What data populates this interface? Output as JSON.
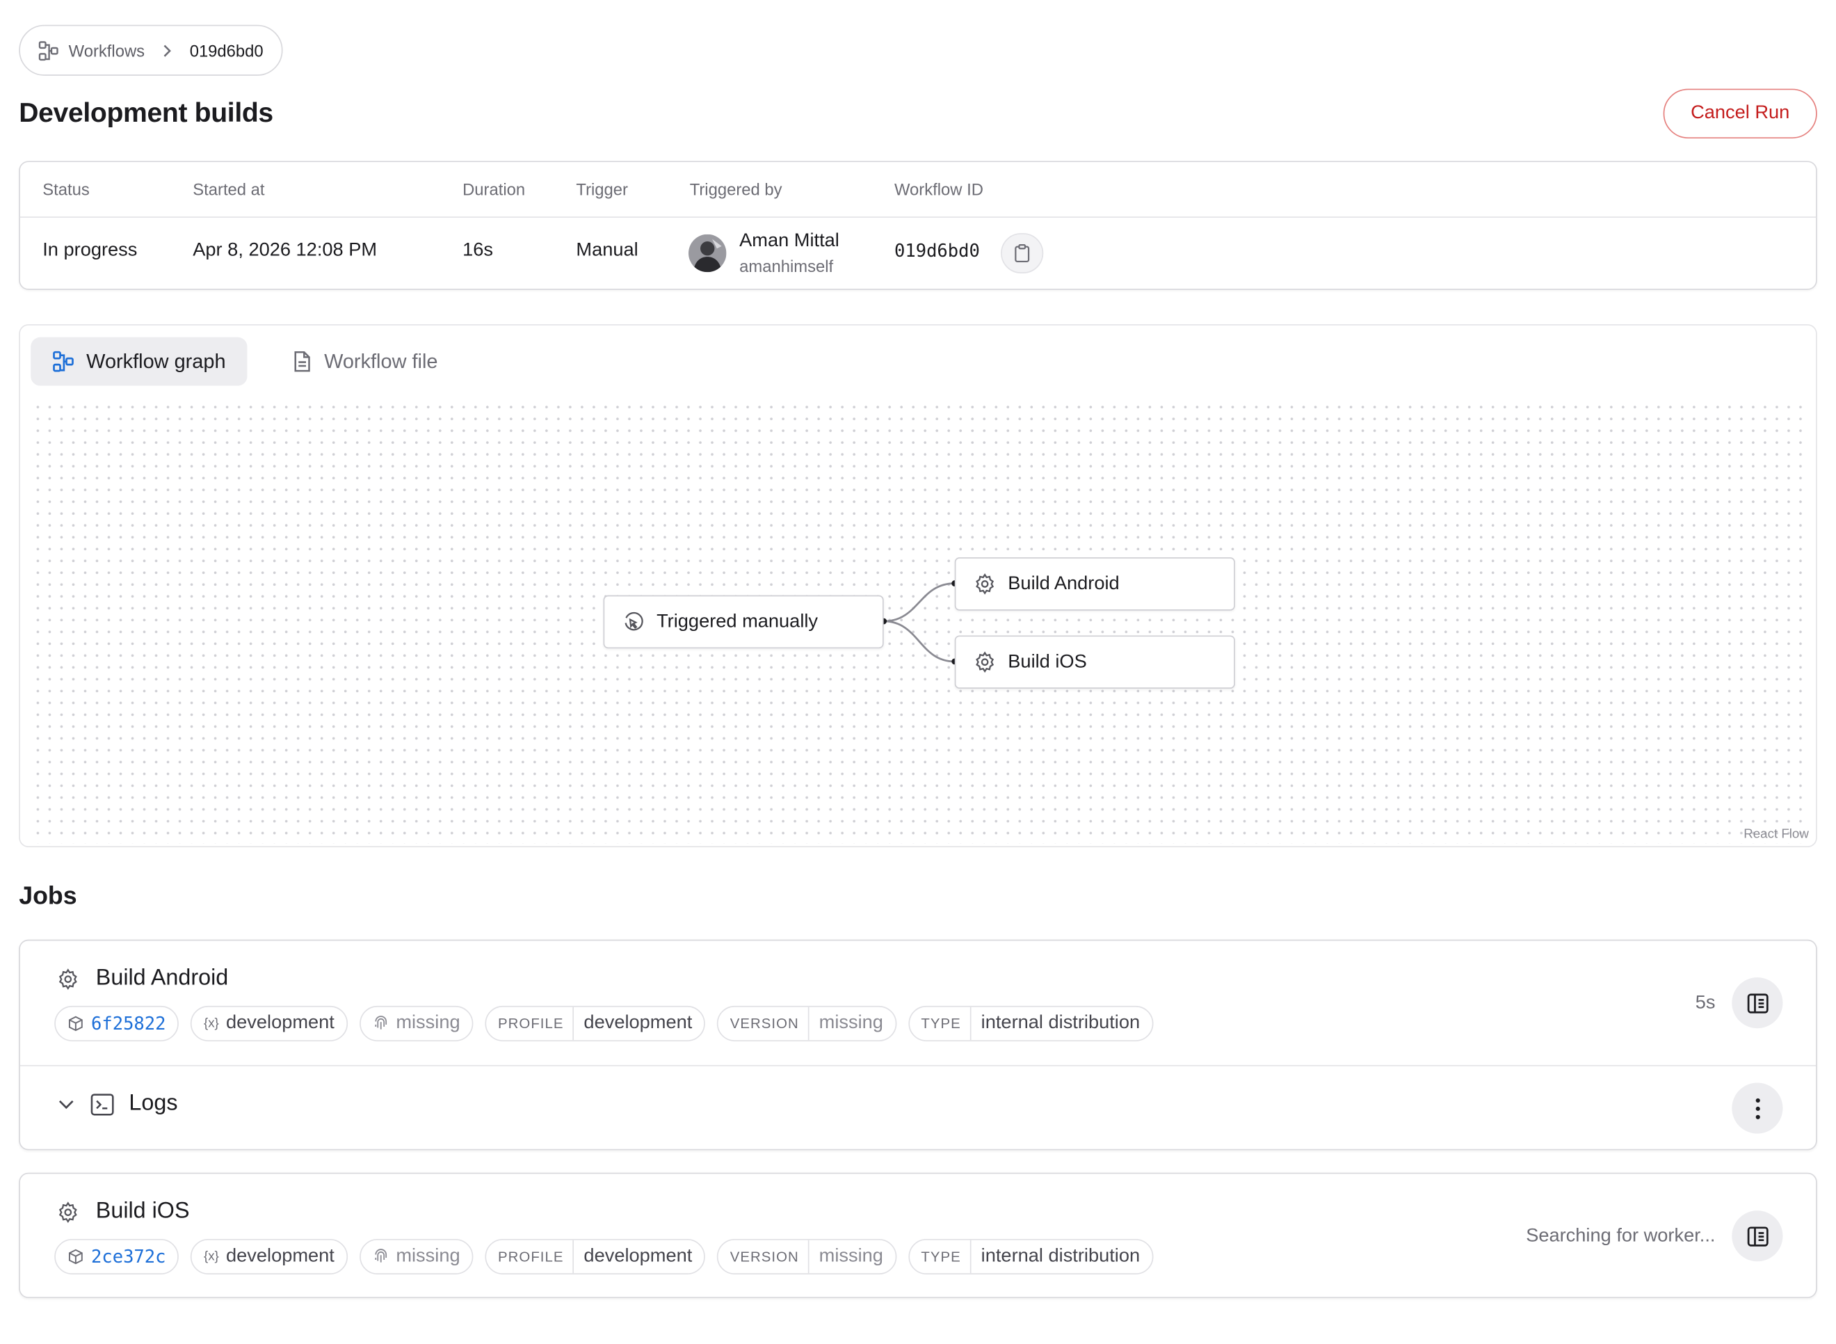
{
  "breadcrumb": {
    "root": "Workflows",
    "current": "019d6bd0"
  },
  "header": {
    "title": "Development builds",
    "cancel_label": "Cancel Run"
  },
  "run": {
    "headers": {
      "status": "Status",
      "started_at": "Started at",
      "duration": "Duration",
      "trigger": "Trigger",
      "triggered_by": "Triggered by",
      "workflow_id": "Workflow ID"
    },
    "status": "In progress",
    "started_at": "Apr 8, 2026 12:08 PM",
    "duration": "16s",
    "trigger": "Manual",
    "user_name": "Aman Mittal",
    "user_handle": "amanhimself",
    "workflow_id": "019d6bd0"
  },
  "graph": {
    "tabs": [
      {
        "label": "Workflow graph",
        "active": true
      },
      {
        "label": "Workflow file",
        "active": false
      }
    ],
    "nodes": {
      "trigger": "Triggered manually",
      "android": "Build Android",
      "ios": "Build iOS"
    },
    "attribution": "React Flow"
  },
  "jobs": {
    "title": "Jobs",
    "items": [
      {
        "name": "Build Android",
        "commit": "6f25822",
        "environment": "development",
        "fingerprint": "missing",
        "profile_key": "PROFILE",
        "profile": "development",
        "version_key": "VERSION",
        "version": "missing",
        "type_key": "TYPE",
        "type": "internal distribution",
        "status_text": "5s",
        "logs_label": "Logs"
      },
      {
        "name": "Build iOS",
        "commit": "2ce372c",
        "environment": "development",
        "fingerprint": "missing",
        "profile_key": "PROFILE",
        "profile": "development",
        "version_key": "VERSION",
        "version": "missing",
        "type_key": "TYPE",
        "type": "internal distribution",
        "status_text": "Searching for worker..."
      }
    ]
  },
  "colors": {
    "danger": "#c41c1c",
    "link": "#1d6fd8",
    "accent_icon": "#1d6fd8",
    "border": "#d8d8dc"
  },
  "icons": {
    "breadcrumb": "workflow-icon",
    "copy": "clipboard-icon",
    "tab_graph": "workflow-icon",
    "tab_file": "file-icon",
    "trigger_node": "manual-trigger-icon",
    "job": "gear-icon",
    "commit": "cube-icon",
    "environment": "variable-icon",
    "fingerprint": "fingerprint-icon",
    "logs_toggle": "chevron-down-icon",
    "logs": "terminal-icon",
    "panel": "sidebar-panel-icon",
    "more": "more-vertical-icon"
  }
}
